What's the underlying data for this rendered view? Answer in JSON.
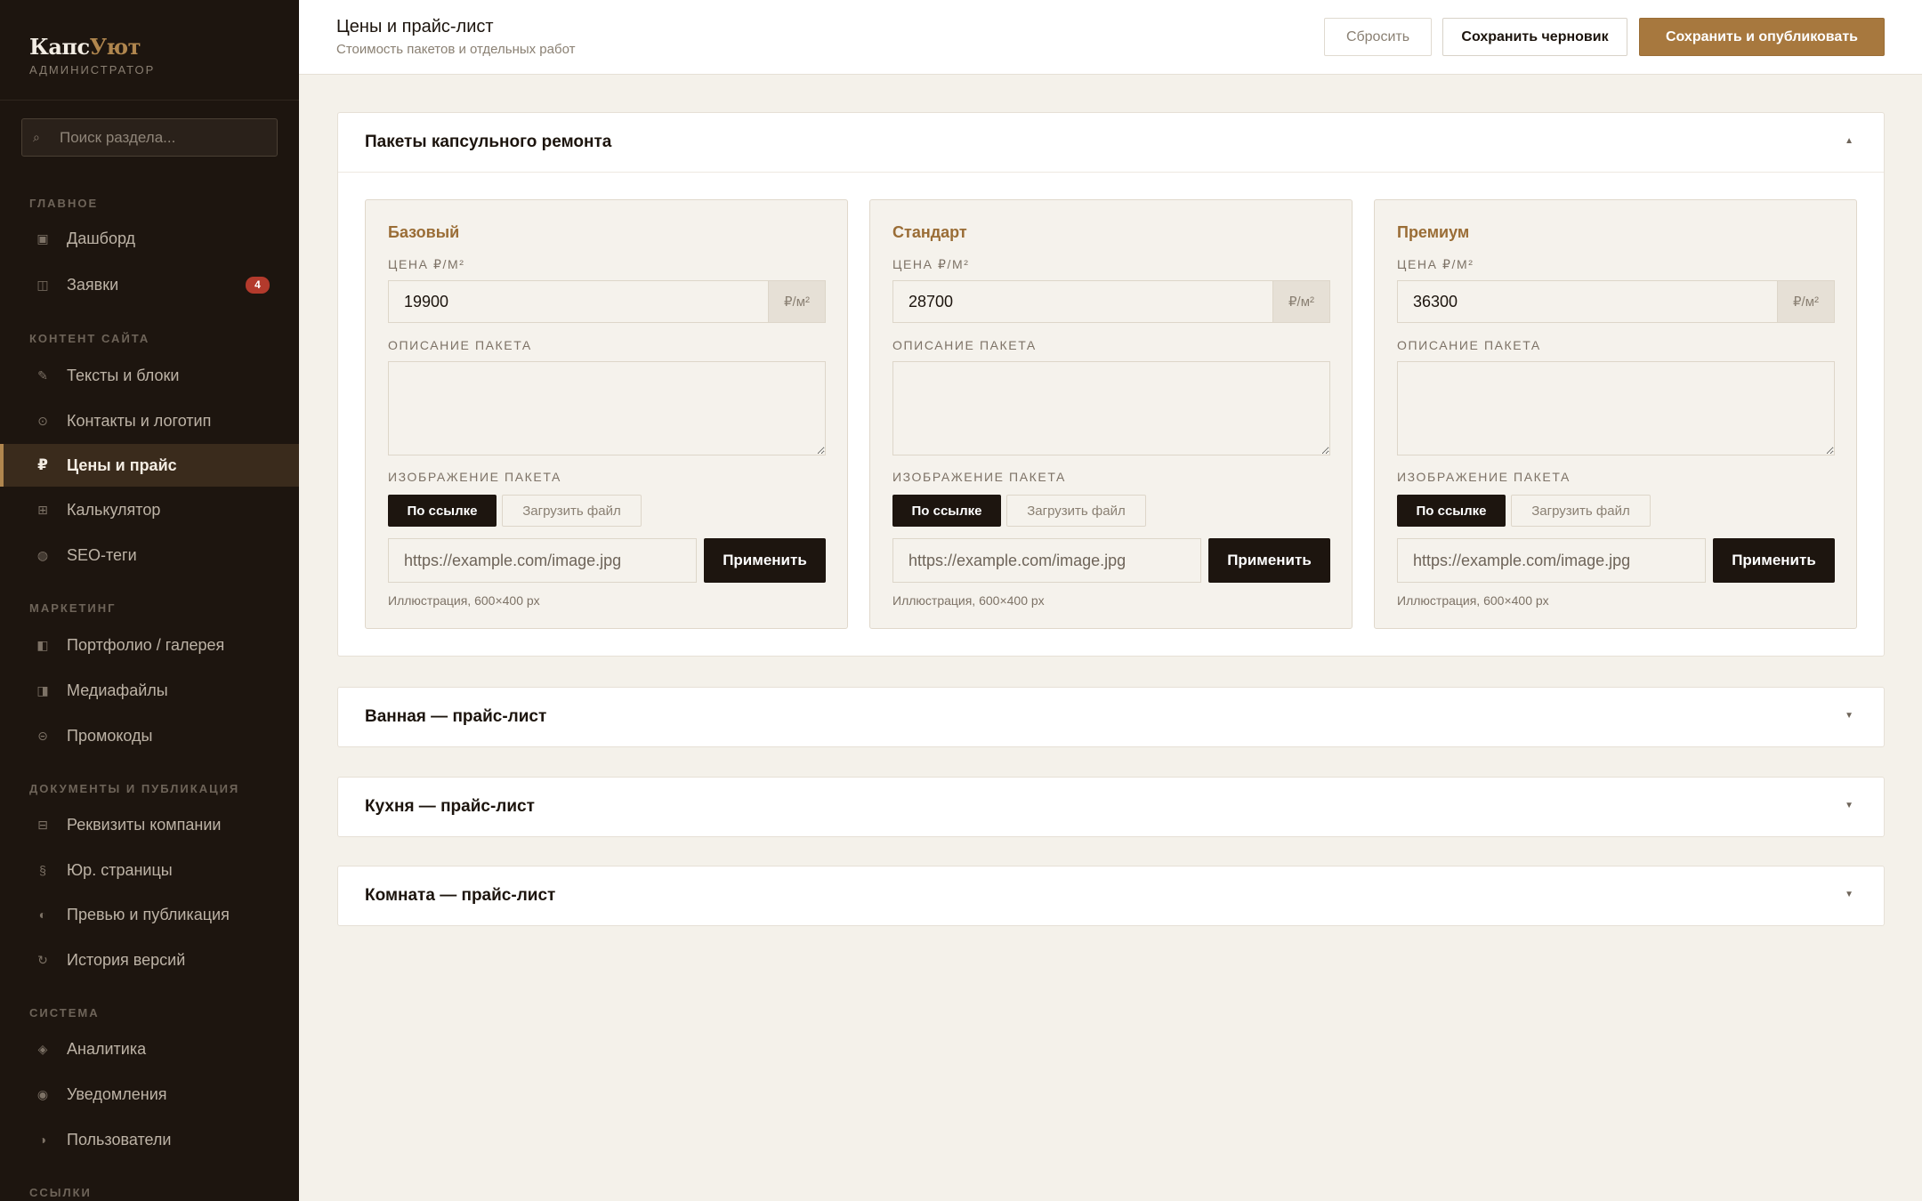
{
  "brand": {
    "name_main": "Капс",
    "name_accent": "Уют",
    "role": "АДМИНИСТРАТОР"
  },
  "sidebar": {
    "search_placeholder": "Поиск раздела...",
    "search_icon": "search-icon",
    "sections": [
      {
        "title": "ГЛАВНОЕ",
        "items": [
          {
            "label": "Дашборд",
            "icon": "dashboard-icon",
            "glyph": "▣"
          },
          {
            "label": "Заявки",
            "icon": "inbox-icon",
            "glyph": "◫",
            "badge": "4"
          }
        ]
      },
      {
        "title": "КОНТЕНТ САЙТА",
        "items": [
          {
            "label": "Тексты и блоки",
            "icon": "pencil-icon",
            "glyph": "✎"
          },
          {
            "label": "Контакты и логотип",
            "icon": "contact-icon",
            "glyph": "⊙"
          },
          {
            "label": "Цены и прайс",
            "icon": "ruble-icon",
            "glyph": "₽",
            "active": true
          },
          {
            "label": "Калькулятор",
            "icon": "calculator-icon",
            "glyph": "⊞"
          },
          {
            "label": "SEO-теги",
            "icon": "seo-icon",
            "glyph": "◍"
          }
        ]
      },
      {
        "title": "МАРКЕТИНГ",
        "items": [
          {
            "label": "Портфолио / галерея",
            "icon": "gallery-icon",
            "glyph": "◧"
          },
          {
            "label": "Медиафайлы",
            "icon": "media-icon",
            "glyph": "◨"
          },
          {
            "label": "Промокоды",
            "icon": "promo-icon",
            "glyph": "⊝"
          }
        ]
      },
      {
        "title": "ДОКУМЕНТЫ И ПУБЛИКАЦИЯ",
        "items": [
          {
            "label": "Реквизиты компании",
            "icon": "requisites-icon",
            "glyph": "⊟"
          },
          {
            "label": "Юр. страницы",
            "icon": "legal-icon",
            "glyph": "§"
          },
          {
            "label": "Превью и публикация",
            "icon": "preview-icon",
            "glyph": "◐"
          },
          {
            "label": "История версий",
            "icon": "history-icon",
            "glyph": "↻"
          }
        ]
      },
      {
        "title": "СИСТЕМА",
        "items": [
          {
            "label": "Аналитика",
            "icon": "analytics-icon",
            "glyph": "◈"
          },
          {
            "label": "Уведомления",
            "icon": "bell-icon",
            "glyph": "◉"
          },
          {
            "label": "Пользователи",
            "icon": "users-icon",
            "glyph": "◑"
          }
        ]
      },
      {
        "title": "ССЫЛКИ",
        "items": []
      }
    ]
  },
  "header": {
    "title": "Цены и прайс-лист",
    "subtitle": "Стоимость пакетов и отдельных работ",
    "reset_label": "Сбросить",
    "draft_label": "Сохранить черновик",
    "publish_label": "Сохранить и опубликовать"
  },
  "packages_panel": {
    "title": "Пакеты капсульного ремонта",
    "expanded": true,
    "cards": [
      {
        "name": "Базовый",
        "price_label": "ЦЕНА ₽/М²",
        "price": "19900",
        "unit": "₽/м²",
        "desc_label": "ОПИСАНИЕ ПАКЕТА",
        "description": "",
        "image_label": "ИЗОБРАЖЕНИЕ ПАКЕТА",
        "tab_link": "По ссылке",
        "tab_file": "Загрузить файл",
        "url_placeholder": "https://example.com/image.jpg",
        "apply": "Применить",
        "hint": "Иллюстрация, 600×400 px"
      },
      {
        "name": "Стандарт",
        "price_label": "ЦЕНА ₽/М²",
        "price": "28700",
        "unit": "₽/м²",
        "desc_label": "ОПИСАНИЕ ПАКЕТА",
        "description": "",
        "image_label": "ИЗОБРАЖЕНИЕ ПАКЕТА",
        "tab_link": "По ссылке",
        "tab_file": "Загрузить файл",
        "url_placeholder": "https://example.com/image.jpg",
        "apply": "Применить",
        "hint": "Иллюстрация, 600×400 px"
      },
      {
        "name": "Премиум",
        "price_label": "ЦЕНА ₽/М²",
        "price": "36300",
        "unit": "₽/м²",
        "desc_label": "ОПИСАНИЕ ПАКЕТА",
        "description": "",
        "image_label": "ИЗОБРАЖЕНИЕ ПАКЕТА",
        "tab_link": "По ссылке",
        "tab_file": "Загрузить файл",
        "url_placeholder": "https://example.com/image.jpg",
        "apply": "Применить",
        "hint": "Иллюстрация, 600×400 px"
      }
    ]
  },
  "collapsed_panels": [
    {
      "title": "Ванная — прайс-лист"
    },
    {
      "title": "Кухня — прайс-лист"
    },
    {
      "title": "Комната — прайс-лист"
    }
  ],
  "colors": {
    "sidebar_bg": "#1d150f",
    "accent": "#a7783e",
    "page_bg": "#f4f1ea",
    "badge": "#b33a2c"
  }
}
